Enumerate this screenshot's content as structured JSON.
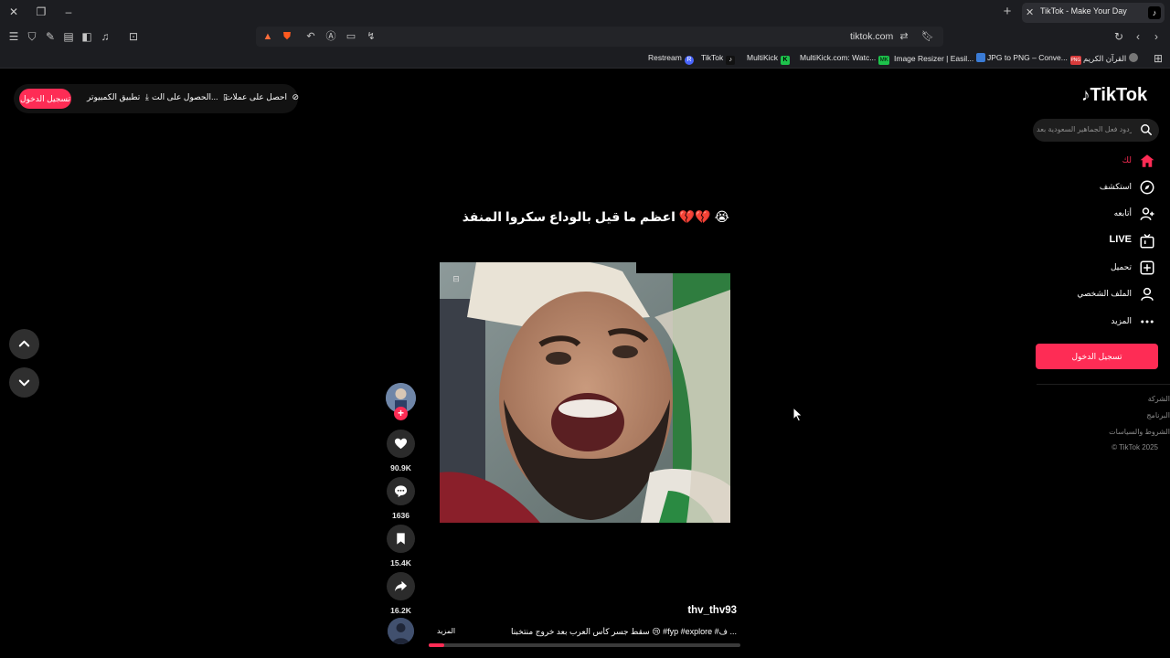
{
  "browser": {
    "tab_title": "TikTok - Make Your Day",
    "url": "tiktok.com",
    "bookmarks": [
      {
        "label": "Restream",
        "icon": "R",
        "color": "#4a66ff"
      },
      {
        "label": "TikTok",
        "icon": "♪",
        "color": "#111111"
      },
      {
        "label": "MultiKick",
        "icon": "K",
        "color": "#1dc24b"
      },
      {
        "label": "MultiKick.com: Watc...",
        "icon": "MK",
        "color": "#1dc24b"
      },
      {
        "label": "Image Resizer | Easil...",
        "icon": "",
        "color": "#3a7bd5"
      },
      {
        "label": "JPG to PNG – Conve...",
        "icon": "PNG",
        "color": "#d83b3b"
      },
      {
        "label": "القرآن الكريم",
        "icon": "",
        "color": "#555555"
      }
    ]
  },
  "topbar": {
    "login": "تسجيل الدخول",
    "desktop_app": "تطبيق الكمبيوتر",
    "get_app": "الحصول على الت...",
    "coins": "احصل على عملات"
  },
  "sidebar": {
    "logo": "TikTok",
    "search_placeholder": "زدود فعل الجماهير السعودية بعد ...",
    "nav": [
      {
        "label": "لك",
        "icon": "home-icon",
        "active": true
      },
      {
        "label": "استكشف",
        "icon": "compass-icon",
        "active": false
      },
      {
        "label": "أتابعه",
        "icon": "following-icon",
        "active": false
      },
      {
        "label": "LIVE",
        "icon": "live-icon",
        "active": false
      },
      {
        "label": "تحميل",
        "icon": "upload-icon",
        "active": false
      },
      {
        "label": "الملف الشخصي",
        "icon": "profile-icon",
        "active": false
      },
      {
        "label": "المزيد",
        "icon": "more-icon",
        "active": false
      }
    ],
    "login_button": "تسجيل الدخول",
    "footer": [
      "الشركة",
      "البرنامج",
      "الشروط والسياسات",
      "© TikTok 2025"
    ]
  },
  "video": {
    "caption": "اعظم ما قيل بالوداع سكروا المنفذ 💔💔 😭",
    "author": "thv_thv93",
    "description": "سقط جسر كأس العرب بعد خروج منتخبنا 😢 #fyp #explore #ف ...",
    "more_label": "المزيد",
    "progress": 0.05,
    "stats": {
      "likes": "90.9K",
      "comments": "1636",
      "saves": "15.4K",
      "shares": "16.2K"
    }
  },
  "colors": {
    "accent": "#fe2c55",
    "background": "#000000",
    "chrome": "#1c1d21"
  }
}
